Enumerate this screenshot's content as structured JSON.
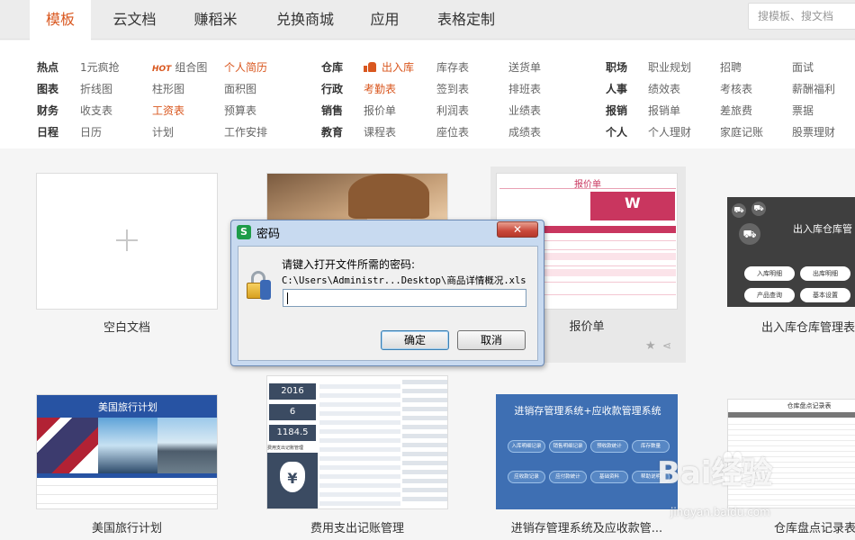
{
  "nav": {
    "tabs": [
      {
        "label": "模板",
        "active": true
      },
      {
        "label": "云文档"
      },
      {
        "label": "赚稻米"
      },
      {
        "label": "兑换商城"
      },
      {
        "label": "应用"
      },
      {
        "label": "表格定制"
      }
    ],
    "search_placeholder": "搜模板、搜文档"
  },
  "categories": {
    "col1": [
      {
        "head": "热点",
        "items": [
          "1元疯抢",
          "组合图",
          "个人简历"
        ],
        "hot_badge": "HOT"
      },
      {
        "head": "图表",
        "items": [
          "折线图",
          "柱形图",
          "面积图"
        ]
      },
      {
        "head": "财务",
        "items": [
          "收支表",
          "工资表",
          "预算表"
        ]
      },
      {
        "head": "日程",
        "items": [
          "日历",
          "计划",
          "工作安排"
        ]
      }
    ],
    "col2": [
      {
        "head": "仓库",
        "items": [
          "出入库",
          "库存表",
          "送货单"
        ]
      },
      {
        "head": "行政",
        "items": [
          "考勤表",
          "签到表",
          "排班表"
        ]
      },
      {
        "head": "销售",
        "items": [
          "报价单",
          "利润表",
          "业绩表"
        ]
      },
      {
        "head": "教育",
        "items": [
          "课程表",
          "座位表",
          "成绩表"
        ]
      }
    ],
    "col3": [
      {
        "head": "职场",
        "items": [
          "职业规划",
          "招聘",
          "面试"
        ]
      },
      {
        "head": "人事",
        "items": [
          "绩效表",
          "考核表",
          "薪酬福利"
        ]
      },
      {
        "head": "报销",
        "items": [
          "报销单",
          "差旅费",
          "票据"
        ]
      },
      {
        "head": "个人",
        "items": [
          "个人理财",
          "家庭记账",
          "股票理财"
        ]
      }
    ]
  },
  "templates": {
    "row1": [
      {
        "caption": "空白文档"
      },
      {
        "caption": ""
      },
      {
        "caption": "报价单",
        "inner_title": "报价单",
        "brand_letter": "W"
      },
      {
        "caption": "出入库仓库管理表",
        "inner_title": "出入库仓库管",
        "buttons": [
          "入库明细",
          "出库明细",
          "产品查询",
          "基本设置"
        ]
      }
    ],
    "row2": [
      {
        "caption": "美国旅行计划",
        "inner_title": "美国旅行计划"
      },
      {
        "caption": "费用支出记账管理",
        "year": "2016",
        "month": "6",
        "amount": "1184.5",
        "inner_title": "费用支出记账管理",
        "currency": "¥"
      },
      {
        "caption": "进销存管理系统及应收款管...",
        "inner_title": "进销存管理系统+应收款管理系统",
        "pills": [
          "入库明细记录",
          "销售明细记录",
          "预收款统计",
          "库存数量",
          "应收款记录",
          "应付款统计",
          "基础资料",
          "帮助说明"
        ]
      },
      {
        "caption": "仓库盘点记录表",
        "inner_title": "仓库盘点记录表"
      }
    ]
  },
  "dialog": {
    "title": "密码",
    "app_icon": "S",
    "close_label": "✕",
    "prompt": "请键入打开文件所需的密码:",
    "path": "C:\\Users\\Administr...Desktop\\商品详情概况.xls",
    "ok_label": "确定",
    "cancel_label": "取消"
  },
  "watermark": {
    "text": "Bai经验",
    "url": "jingyan.baidu.com"
  },
  "colors": {
    "accent": "#d9571f",
    "dialog_frame": "#c8daf0",
    "card_pink": "#c9365f",
    "card_dark": "#3f3f3f",
    "card_blue": "#3e6fb3"
  }
}
